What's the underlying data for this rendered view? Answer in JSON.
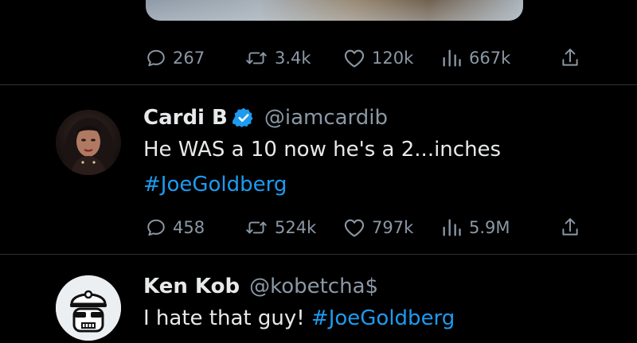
{
  "tweets": [
    {
      "stats": {
        "replies": "267",
        "retweets": "3.4k",
        "likes": "120k",
        "views": "667k"
      }
    },
    {
      "display_name": "Cardi B",
      "handle": "@iamcardib",
      "text": "He WAS a 10 now he's a 2...inches",
      "hashtag": "#JoeGoldberg",
      "verified": true,
      "stats": {
        "replies": "458",
        "retweets": "524k",
        "likes": "797k",
        "views": "5.9M"
      }
    },
    {
      "display_name": "Ken Kob",
      "handle": "@kobetcha$",
      "text": "I hate that guy!",
      "hashtag": "#JoeGoldberg"
    }
  ],
  "colors": {
    "background": "#000000",
    "text": "#e7e9ea",
    "muted": "#8b98a5",
    "link": "#1d9bf0",
    "divider": "#2f3336"
  }
}
